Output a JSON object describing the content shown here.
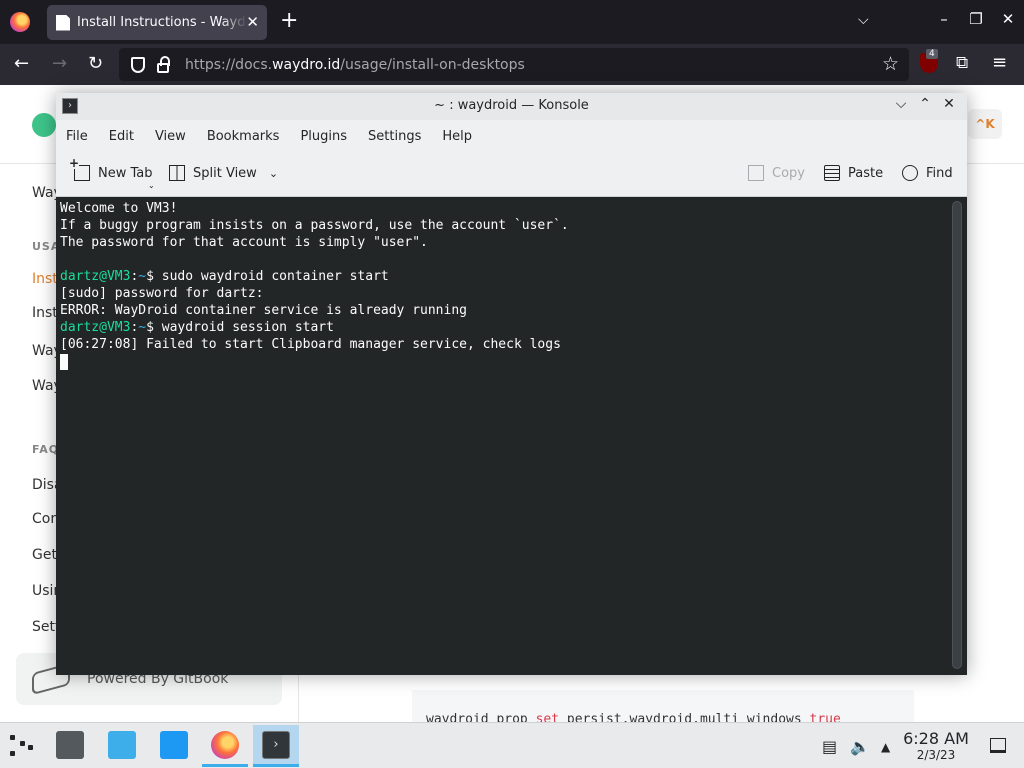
{
  "browser": {
    "tab_title": "Install Instructions - Waydroid",
    "url_prefix": "https://docs.",
    "url_domain": "waydro.id",
    "url_path": "/usage/install-on-desktops",
    "ublock_count": "4"
  },
  "webpage": {
    "shortcut_hint": "^K",
    "sidebar": [
      {
        "label": "Waydroid",
        "kind": "item"
      },
      {
        "label": "USAGE",
        "kind": "section"
      },
      {
        "label": "Install Instructions",
        "kind": "active"
      },
      {
        "label": "Install on Desktops",
        "kind": "item"
      },
      {
        "label": "Waydroid Command Line",
        "kind": "item"
      },
      {
        "label": "Waydroid Prop Options",
        "kind": "item"
      },
      {
        "label": "FAQ",
        "kind": "section"
      },
      {
        "label": "Disable Freeform",
        "kind": "item"
      },
      {
        "label": "Controlling",
        "kind": "item"
      },
      {
        "label": "Get Google",
        "kind": "item"
      },
      {
        "label": "Using Waydroid",
        "kind": "item"
      },
      {
        "label": "Setting Up",
        "kind": "item"
      }
    ],
    "powered_by": "Powered By GitBook",
    "code_prefix": "waydroid prop ",
    "code_keyword": "set",
    "code_middle": " persist.waydroid.multi_windows ",
    "code_value": "true"
  },
  "konsole": {
    "window_title": "~ : waydroid — Konsole",
    "menu": [
      "File",
      "Edit",
      "View",
      "Bookmarks",
      "Plugins",
      "Settings",
      "Help"
    ],
    "toolbar": {
      "new_tab": "New Tab",
      "split_view": "Split View",
      "copy": "Copy",
      "paste": "Paste",
      "find": "Find"
    },
    "terminal": {
      "welcome": [
        "Welcome to VM3!",
        "If a buggy program insists on a password, use the account `user`.",
        "The password for that account is simply \"user\"."
      ],
      "prompt_user": "dartz@VM3",
      "prompt_path": "~",
      "cmd1": "sudo waydroid container start",
      "out1": "[sudo] password for dartz:",
      "out2": "ERROR: WayDroid container service is already running",
      "cmd2": "waydroid session start",
      "out3": "[06:27:08] Failed to start Clipboard manager service, check logs"
    }
  },
  "panel": {
    "time": "6:28 AM",
    "date": "2/3/23"
  }
}
